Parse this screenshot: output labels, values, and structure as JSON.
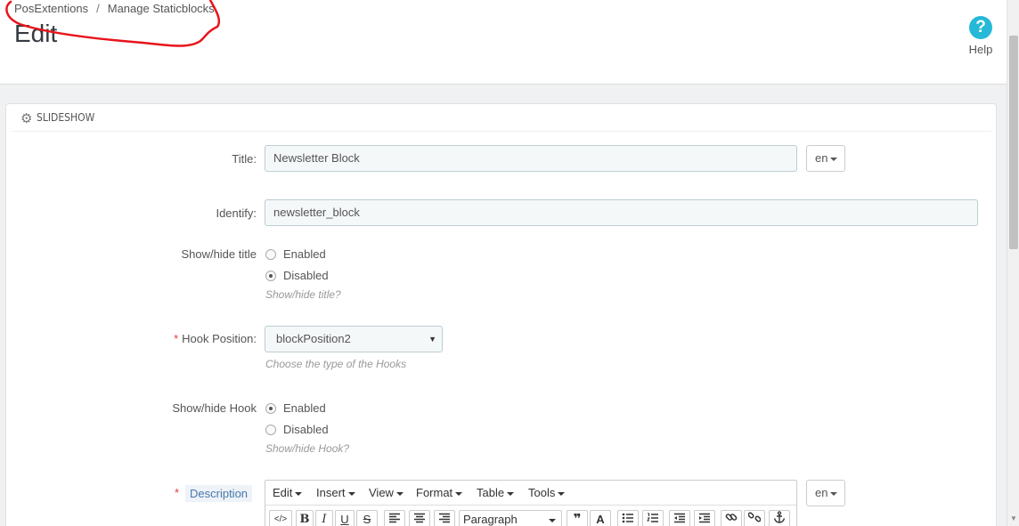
{
  "breadcrumb": {
    "item1": "PosExtentions",
    "separator": "/",
    "item2": "Manage Staticblocks"
  },
  "page": {
    "title": "Edit"
  },
  "help": {
    "icon": "?",
    "label": "Help"
  },
  "panel": {
    "heading": "SLIDESHOW"
  },
  "form": {
    "title_label": "Title:",
    "title_value": "Newsletter Block",
    "title_lang": "en",
    "identify_label": "Identify:",
    "identify_value": "newsletter_block",
    "show_title_label": "Show/hide title",
    "show_title_enabled": "Enabled",
    "show_title_disabled": "Disabled",
    "show_title_help": "Show/hide title?",
    "hook_required": "*",
    "hook_label": "Hook Position:",
    "hook_value": "blockPosition2",
    "hook_help": "Choose the type of the Hooks",
    "show_hook_label": "Show/hide Hook",
    "show_hook_enabled": "Enabled",
    "show_hook_disabled": "Disabled",
    "show_hook_help": "Show/hide Hook?",
    "desc_required": "*",
    "desc_label": "Description",
    "desc_lang": "en"
  },
  "editor": {
    "menus": [
      "Edit",
      "Insert",
      "View",
      "Format",
      "Table",
      "Tools"
    ],
    "toolbar": {
      "code": "</>",
      "bold": "B",
      "italic": "I",
      "underline": "U",
      "strike": "S",
      "paragraph": "Paragraph",
      "quote": "❞",
      "textcolor": "A"
    }
  },
  "colors": {
    "accent": "#25b9d7",
    "required": "#e03b3b",
    "scribble": "#e8141b"
  }
}
